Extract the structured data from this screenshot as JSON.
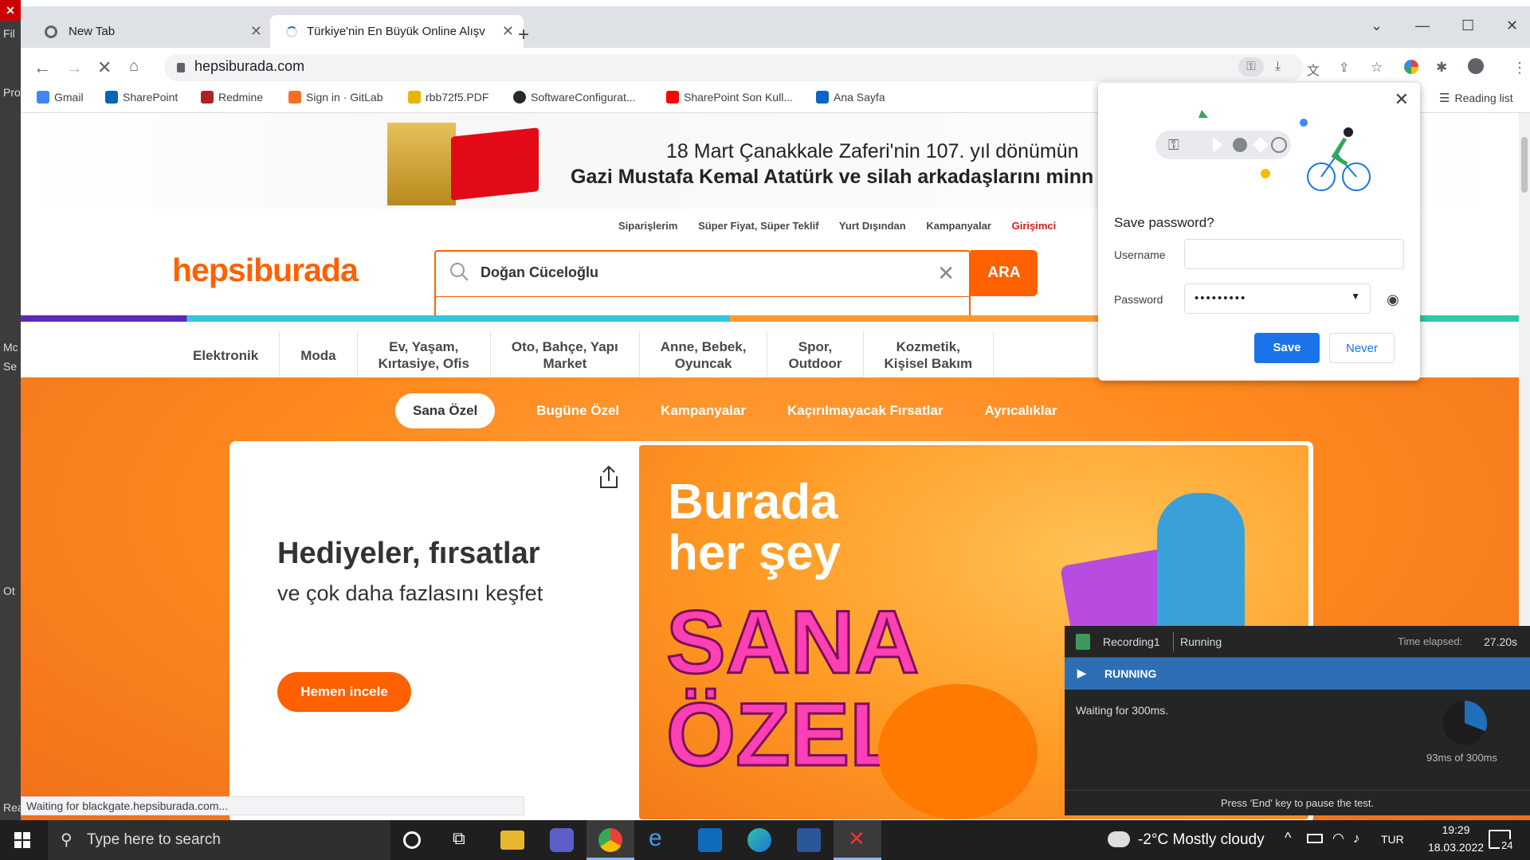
{
  "left_app": {
    "labels": [
      "Fil",
      "Pro",
      "Mc",
      "Se",
      "Ot",
      "Rea"
    ]
  },
  "tabs": [
    {
      "label": "New Tab",
      "close": "✕"
    },
    {
      "label": "Türkiye'nin En Büyük Online Alışv",
      "close": "✕"
    }
  ],
  "toolbar": {
    "url": "hepsiburada.com"
  },
  "bookmarks": [
    {
      "label": "Gmail",
      "icon": "gmail-icon",
      "color": "#4285f4"
    },
    {
      "label": "SharePoint",
      "icon": "sharepoint-icon",
      "color": "#0364b8"
    },
    {
      "label": "Redmine",
      "icon": "redmine-icon",
      "color": "#b32024"
    },
    {
      "label": "Sign in · GitLab",
      "icon": "gitlab-icon",
      "color": "#fc6d26"
    },
    {
      "label": "rbb72f5.PDF",
      "icon": "pdf-icon",
      "color": "#e8b500"
    },
    {
      "label": "SoftwareConfigurat...",
      "icon": "github-icon",
      "color": "#24292e"
    },
    {
      "label": "SharePoint Son Kull...",
      "icon": "youtube-icon",
      "color": "#ff0000"
    },
    {
      "label": "Ana Sayfa",
      "icon": "linkedin-icon",
      "color": "#0a66c2"
    }
  ],
  "reading_list": "Reading list",
  "page": {
    "banner_line1": "18 Mart Çanakkale Zaferi'nin 107. yıl dönümün",
    "banner_line2": "Gazi Mustafa Kemal Atatürk ve silah arkadaşlarını minn",
    "top_links": [
      "Siparişlerim",
      "Süper Fiyat, Süper Teklif",
      "Yurt Dışından",
      "Kampanyalar",
      "Girişimci"
    ],
    "logo": "hepsiburada",
    "search_value": "Doğan Cüceloğlu",
    "search_button": "ARA",
    "categories": [
      {
        "line1": "Elektronik",
        "line2": ""
      },
      {
        "line1": "Moda",
        "line2": ""
      },
      {
        "line1": "Ev, Yaşam,",
        "line2": "Kırtasiye, Ofis"
      },
      {
        "line1": "Oto, Bahçe, Yapı",
        "line2": "Market"
      },
      {
        "line1": "Anne, Bebek,",
        "line2": "Oyuncak"
      },
      {
        "line1": "Spor,",
        "line2": "Outdoor"
      },
      {
        "line1": "Kozmetik,",
        "line2": "Kişisel Bakım"
      }
    ],
    "hero_tabs": [
      "Sana Özel",
      "Bugüne Özel",
      "Kampanyalar",
      "Kaçırılmayacak Fırsatlar",
      "Ayrıcalıklar"
    ],
    "hero_title": "Hediyeler, fırsatlar",
    "hero_subtitle": "ve çok daha fazlasını keşfet",
    "hero_button": "Hemen incele",
    "promo_line1": "Burada",
    "promo_line2": "her şey",
    "promo_line3": "SANA",
    "promo_line4": "ÖZEL"
  },
  "status_bar": "Waiting for blackgate.hepsiburada.com...",
  "password_popup": {
    "title": "Save password?",
    "username_label": "Username",
    "username_value": "",
    "password_label": "Password",
    "password_value": "•••••••••",
    "save": "Save",
    "never": "Never"
  },
  "recorder": {
    "name": "Recording1",
    "state": "Running",
    "elapsed_label": "Time elapsed:",
    "elapsed_value": "27.20s",
    "banner": "RUNNING",
    "message": "Waiting for 300ms.",
    "progress_text": "93ms of 300ms",
    "progress_fraction": 0.31,
    "footer": "Press 'End' key to pause the test."
  },
  "taskbar": {
    "search_placeholder": "Type here to search",
    "weather": "-2°C  Mostly cloudy",
    "lang": "TUR",
    "time": "19:29",
    "date": "18.03.2022",
    "notifications": "24"
  }
}
